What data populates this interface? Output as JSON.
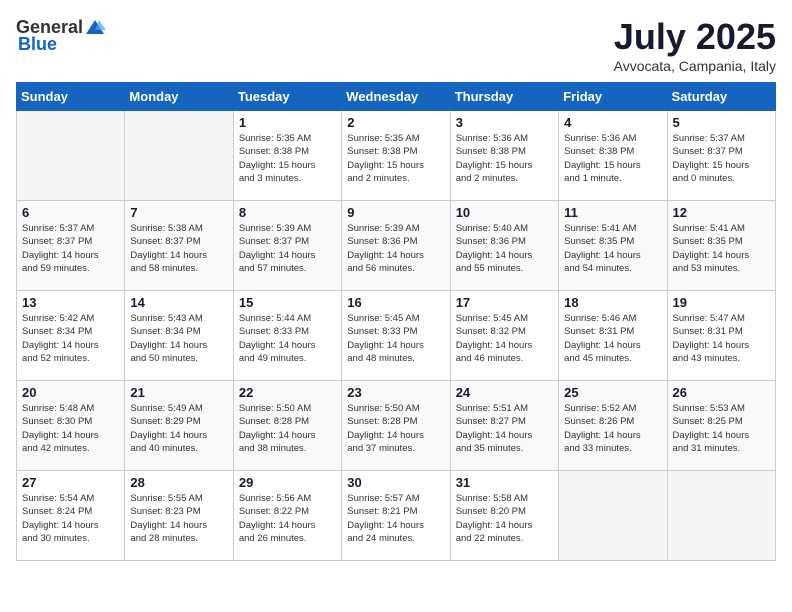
{
  "logo": {
    "text_general": "General",
    "text_blue": "Blue"
  },
  "title": "July 2025",
  "subtitle": "Avvocata, Campania, Italy",
  "headers": [
    "Sunday",
    "Monday",
    "Tuesday",
    "Wednesday",
    "Thursday",
    "Friday",
    "Saturday"
  ],
  "weeks": [
    [
      {
        "day": "",
        "info": ""
      },
      {
        "day": "",
        "info": ""
      },
      {
        "day": "1",
        "info": "Sunrise: 5:35 AM\nSunset: 8:38 PM\nDaylight: 15 hours\nand 3 minutes."
      },
      {
        "day": "2",
        "info": "Sunrise: 5:35 AM\nSunset: 8:38 PM\nDaylight: 15 hours\nand 2 minutes."
      },
      {
        "day": "3",
        "info": "Sunrise: 5:36 AM\nSunset: 8:38 PM\nDaylight: 15 hours\nand 2 minutes."
      },
      {
        "day": "4",
        "info": "Sunrise: 5:36 AM\nSunset: 8:38 PM\nDaylight: 15 hours\nand 1 minute."
      },
      {
        "day": "5",
        "info": "Sunrise: 5:37 AM\nSunset: 8:37 PM\nDaylight: 15 hours\nand 0 minutes."
      }
    ],
    [
      {
        "day": "6",
        "info": "Sunrise: 5:37 AM\nSunset: 8:37 PM\nDaylight: 14 hours\nand 59 minutes."
      },
      {
        "day": "7",
        "info": "Sunrise: 5:38 AM\nSunset: 8:37 PM\nDaylight: 14 hours\nand 58 minutes."
      },
      {
        "day": "8",
        "info": "Sunrise: 5:39 AM\nSunset: 8:37 PM\nDaylight: 14 hours\nand 57 minutes."
      },
      {
        "day": "9",
        "info": "Sunrise: 5:39 AM\nSunset: 8:36 PM\nDaylight: 14 hours\nand 56 minutes."
      },
      {
        "day": "10",
        "info": "Sunrise: 5:40 AM\nSunset: 8:36 PM\nDaylight: 14 hours\nand 55 minutes."
      },
      {
        "day": "11",
        "info": "Sunrise: 5:41 AM\nSunset: 8:35 PM\nDaylight: 14 hours\nand 54 minutes."
      },
      {
        "day": "12",
        "info": "Sunrise: 5:41 AM\nSunset: 8:35 PM\nDaylight: 14 hours\nand 53 minutes."
      }
    ],
    [
      {
        "day": "13",
        "info": "Sunrise: 5:42 AM\nSunset: 8:34 PM\nDaylight: 14 hours\nand 52 minutes."
      },
      {
        "day": "14",
        "info": "Sunrise: 5:43 AM\nSunset: 8:34 PM\nDaylight: 14 hours\nand 50 minutes."
      },
      {
        "day": "15",
        "info": "Sunrise: 5:44 AM\nSunset: 8:33 PM\nDaylight: 14 hours\nand 49 minutes."
      },
      {
        "day": "16",
        "info": "Sunrise: 5:45 AM\nSunset: 8:33 PM\nDaylight: 14 hours\nand 48 minutes."
      },
      {
        "day": "17",
        "info": "Sunrise: 5:45 AM\nSunset: 8:32 PM\nDaylight: 14 hours\nand 46 minutes."
      },
      {
        "day": "18",
        "info": "Sunrise: 5:46 AM\nSunset: 8:31 PM\nDaylight: 14 hours\nand 45 minutes."
      },
      {
        "day": "19",
        "info": "Sunrise: 5:47 AM\nSunset: 8:31 PM\nDaylight: 14 hours\nand 43 minutes."
      }
    ],
    [
      {
        "day": "20",
        "info": "Sunrise: 5:48 AM\nSunset: 8:30 PM\nDaylight: 14 hours\nand 42 minutes."
      },
      {
        "day": "21",
        "info": "Sunrise: 5:49 AM\nSunset: 8:29 PM\nDaylight: 14 hours\nand 40 minutes."
      },
      {
        "day": "22",
        "info": "Sunrise: 5:50 AM\nSunset: 8:28 PM\nDaylight: 14 hours\nand 38 minutes."
      },
      {
        "day": "23",
        "info": "Sunrise: 5:50 AM\nSunset: 8:28 PM\nDaylight: 14 hours\nand 37 minutes."
      },
      {
        "day": "24",
        "info": "Sunrise: 5:51 AM\nSunset: 8:27 PM\nDaylight: 14 hours\nand 35 minutes."
      },
      {
        "day": "25",
        "info": "Sunrise: 5:52 AM\nSunset: 8:26 PM\nDaylight: 14 hours\nand 33 minutes."
      },
      {
        "day": "26",
        "info": "Sunrise: 5:53 AM\nSunset: 8:25 PM\nDaylight: 14 hours\nand 31 minutes."
      }
    ],
    [
      {
        "day": "27",
        "info": "Sunrise: 5:54 AM\nSunset: 8:24 PM\nDaylight: 14 hours\nand 30 minutes."
      },
      {
        "day": "28",
        "info": "Sunrise: 5:55 AM\nSunset: 8:23 PM\nDaylight: 14 hours\nand 28 minutes."
      },
      {
        "day": "29",
        "info": "Sunrise: 5:56 AM\nSunset: 8:22 PM\nDaylight: 14 hours\nand 26 minutes."
      },
      {
        "day": "30",
        "info": "Sunrise: 5:57 AM\nSunset: 8:21 PM\nDaylight: 14 hours\nand 24 minutes."
      },
      {
        "day": "31",
        "info": "Sunrise: 5:58 AM\nSunset: 8:20 PM\nDaylight: 14 hours\nand 22 minutes."
      },
      {
        "day": "",
        "info": ""
      },
      {
        "day": "",
        "info": ""
      }
    ]
  ]
}
